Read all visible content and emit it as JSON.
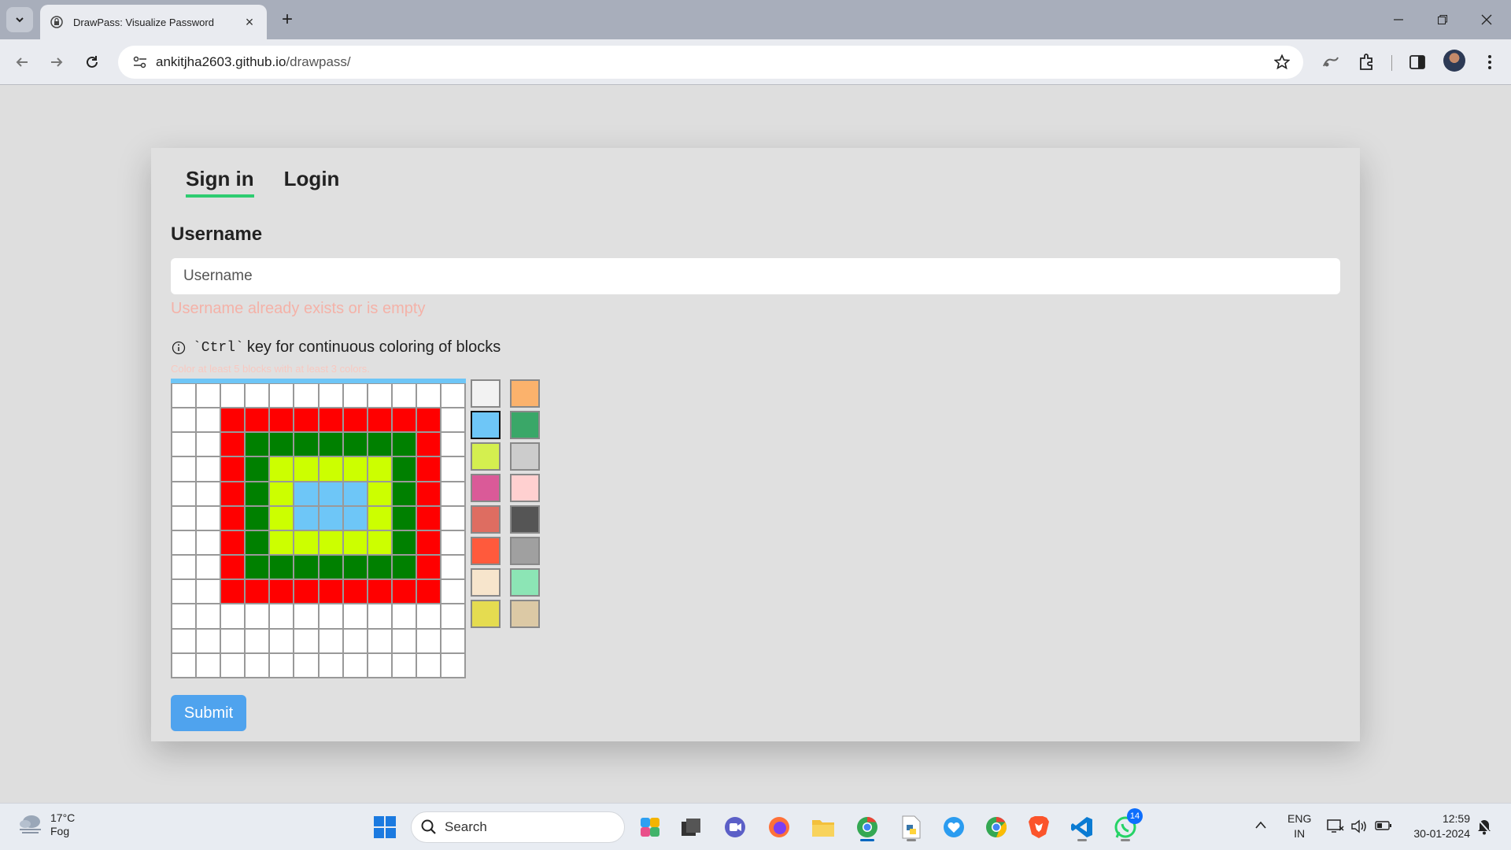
{
  "browser": {
    "tab_title": "DrawPass: Visualize Password",
    "url_host": "ankitjha2603.github.io",
    "url_path": "/drawpass/"
  },
  "page": {
    "tabs": [
      {
        "label": "Sign in",
        "active": true
      },
      {
        "label": "Login",
        "active": false
      }
    ],
    "username_label": "Username",
    "username_placeholder": "Username",
    "username_value": "",
    "error_text": "Username already exists or is empty",
    "hint_code": "`Ctrl`",
    "hint_text": "key for continuous coloring of blocks",
    "subhint": "Color at least 5 blocks with at least 3 colors.",
    "submit_label": "Submit",
    "grid": {
      "rows": [
        [
          "#ffffff",
          "#ffffff",
          "#ffffff",
          "#ffffff",
          "#ffffff",
          "#ffffff",
          "#ffffff",
          "#ffffff",
          "#ffffff",
          "#ffffff",
          "#ffffff",
          "#ffffff"
        ],
        [
          "#ffffff",
          "#ffffff",
          "#ff0000",
          "#ff0000",
          "#ff0000",
          "#ff0000",
          "#ff0000",
          "#ff0000",
          "#ff0000",
          "#ff0000",
          "#ff0000",
          "#ffffff"
        ],
        [
          "#ffffff",
          "#ffffff",
          "#ff0000",
          "#008000",
          "#008000",
          "#008000",
          "#008000",
          "#008000",
          "#008000",
          "#008000",
          "#ff0000",
          "#ffffff"
        ],
        [
          "#ffffff",
          "#ffffff",
          "#ff0000",
          "#008000",
          "#ccff00",
          "#ccff00",
          "#ccff00",
          "#ccff00",
          "#ccff00",
          "#008000",
          "#ff0000",
          "#ffffff"
        ],
        [
          "#ffffff",
          "#ffffff",
          "#ff0000",
          "#008000",
          "#ccff00",
          "#6ec6f7",
          "#6ec6f7",
          "#6ec6f7",
          "#ccff00",
          "#008000",
          "#ff0000",
          "#ffffff"
        ],
        [
          "#ffffff",
          "#ffffff",
          "#ff0000",
          "#008000",
          "#ccff00",
          "#6ec6f7",
          "#6ec6f7",
          "#6ec6f7",
          "#ccff00",
          "#008000",
          "#ff0000",
          "#ffffff"
        ],
        [
          "#ffffff",
          "#ffffff",
          "#ff0000",
          "#008000",
          "#ccff00",
          "#ccff00",
          "#ccff00",
          "#ccff00",
          "#ccff00",
          "#008000",
          "#ff0000",
          "#ffffff"
        ],
        [
          "#ffffff",
          "#ffffff",
          "#ff0000",
          "#008000",
          "#008000",
          "#008000",
          "#008000",
          "#008000",
          "#008000",
          "#008000",
          "#ff0000",
          "#ffffff"
        ],
        [
          "#ffffff",
          "#ffffff",
          "#ff0000",
          "#ff0000",
          "#ff0000",
          "#ff0000",
          "#ff0000",
          "#ff0000",
          "#ff0000",
          "#ff0000",
          "#ff0000",
          "#ffffff"
        ],
        [
          "#ffffff",
          "#ffffff",
          "#ffffff",
          "#ffffff",
          "#ffffff",
          "#ffffff",
          "#ffffff",
          "#ffffff",
          "#ffffff",
          "#ffffff",
          "#ffffff",
          "#ffffff"
        ],
        [
          "#ffffff",
          "#ffffff",
          "#ffffff",
          "#ffffff",
          "#ffffff",
          "#ffffff",
          "#ffffff",
          "#ffffff",
          "#ffffff",
          "#ffffff",
          "#ffffff",
          "#ffffff"
        ],
        [
          "#ffffff",
          "#ffffff",
          "#ffffff",
          "#ffffff",
          "#ffffff",
          "#ffffff",
          "#ffffff",
          "#ffffff",
          "#ffffff",
          "#ffffff",
          "#ffffff",
          "#ffffff"
        ]
      ]
    },
    "palette": [
      "#f2f2f2",
      "#fbb26c",
      "#6ec6f7",
      "#3aa768",
      "#d4ef4f",
      "#cccccc",
      "#da5a98",
      "#ffd0d0",
      "#de6d61",
      "#555555",
      "#ff5a3c",
      "#a0a0a0",
      "#f7e5cc",
      "#8ce5b5",
      "#e5dc50",
      "#dcc9a5"
    ],
    "selected_palette_index": 2
  },
  "taskbar": {
    "temperature": "17°C",
    "weather": "Fog",
    "search_label": "Search",
    "whatsapp_badge": "14",
    "lang_top": "ENG",
    "lang_bottom": "IN",
    "time": "12:59",
    "date": "30-01-2024"
  }
}
